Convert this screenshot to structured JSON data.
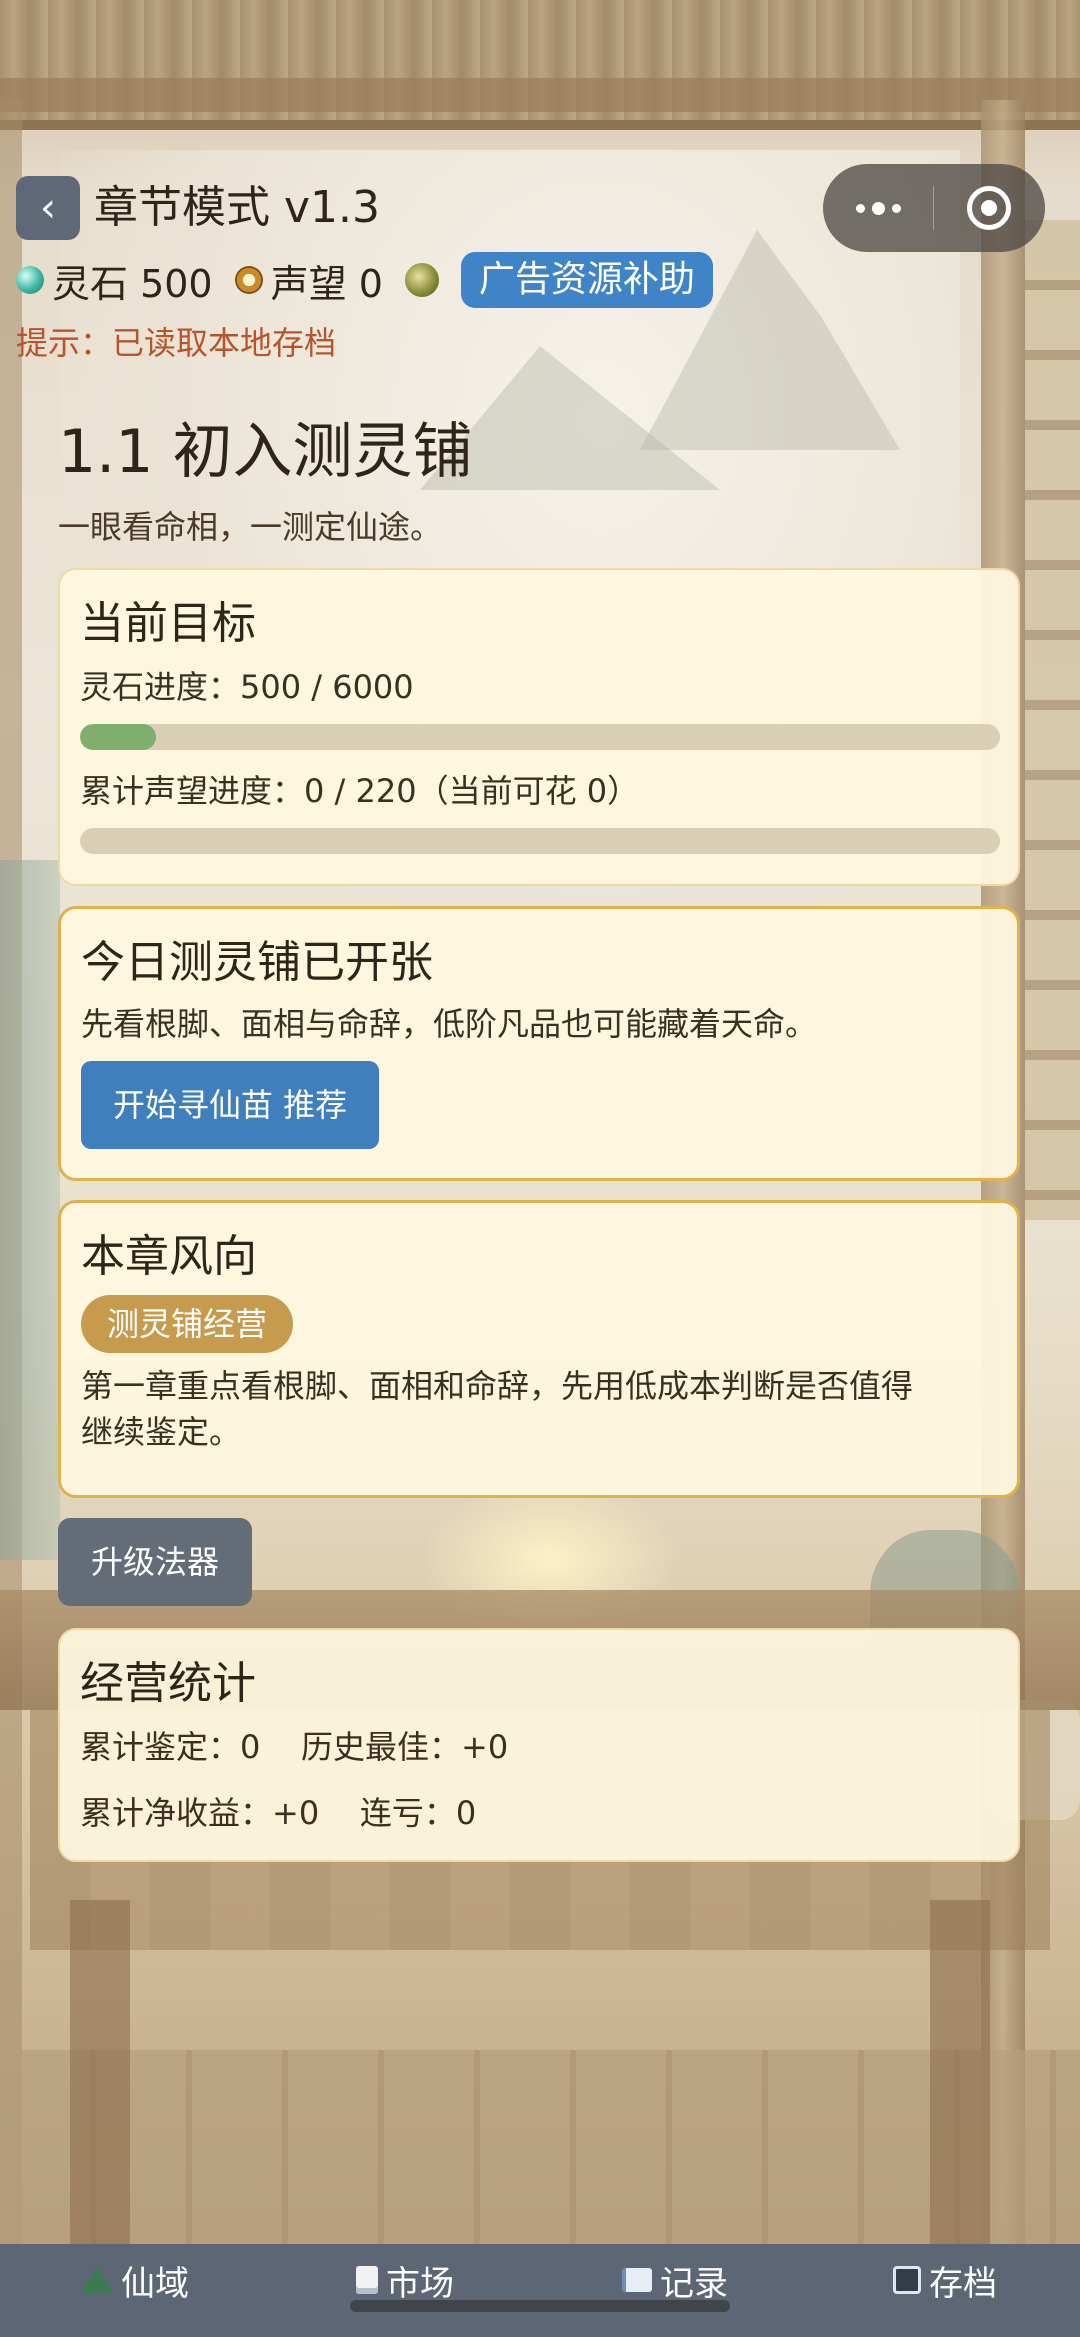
{
  "header": {
    "back_label": "‹",
    "title": "章节模式 v1.3"
  },
  "resources": {
    "stone_label": "灵石 500",
    "fame_label": "声望 0",
    "ad_button": "广告资源补助"
  },
  "tip": "提示：已读取本地存档",
  "chapter": {
    "title": "1.1 初入测灵铺",
    "subtitle": "一眼看命相，一测定仙途。"
  },
  "goal_card": {
    "title": "当前目标",
    "stone_progress_text": "灵石进度：500 / 6000",
    "stone_progress": 0.083,
    "fame_progress_text": "累计声望进度：0 / 220（当前可花 0）",
    "fame_progress": 0
  },
  "shop_card": {
    "title": "今日测灵铺已开张",
    "desc": "先看根脚、面相与命辞，低阶凡品也可能藏着天命。",
    "button": "开始寻仙苗  推荐"
  },
  "trend_card": {
    "title": "本章风向",
    "tag": "测灵铺经营",
    "desc_line1": "第一章重点看根脚、面相和命辞，先用低成本判断是否值得",
    "desc_line2": "继续鉴定。"
  },
  "upgrade_button": "升级法器",
  "stats_card": {
    "title": "经营统计",
    "line1": "累计鉴定：0    历史最佳：+0",
    "line2": "累计净收益：+0    连亏：0"
  },
  "tabbar": {
    "items": [
      {
        "label": "仙域",
        "icon": "mountain-icon"
      },
      {
        "label": "市场",
        "icon": "document-icon"
      },
      {
        "label": "记录",
        "icon": "book-icon"
      },
      {
        "label": "存档",
        "icon": "floppy-disk-icon"
      }
    ]
  },
  "colors": {
    "accent_blue": "#3f7fbd",
    "tag_gold": "#c79b4e",
    "tip_red": "#b8542a",
    "tabbar_bg": "#5d6675"
  }
}
